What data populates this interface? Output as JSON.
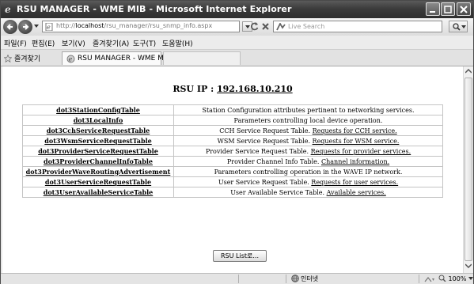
{
  "window": {
    "title": "RSU MANAGER - WME MIB - Microsoft Internet Explorer"
  },
  "address_bar": {
    "url_prefix": "http://",
    "url_host": "localhost",
    "url_path": "/rsu_manager/rsu_snmp_info.aspx",
    "search_placeholder": "Live Search"
  },
  "menu": {
    "items": [
      {
        "label": "파일(F)"
      },
      {
        "label": "편집(E)"
      },
      {
        "label": "보기(V)"
      },
      {
        "label": "즐겨찾기(A)"
      },
      {
        "label": "도구(T)"
      },
      {
        "label": "도움말(H)"
      }
    ]
  },
  "tabs": {
    "favorites_label": "즐겨찾기",
    "active_tab": "RSU MANAGER - WME MIB"
  },
  "page": {
    "heading_label": "RSU IP :",
    "ip": "192.168.10.210",
    "rows": [
      {
        "name": "dot3StationConfigTable",
        "desc": "Station Configuration attributes pertinent to networking services.",
        "link": ""
      },
      {
        "name": "dot3LocalInfo",
        "desc": "Parameters controlling local device operation.",
        "link": ""
      },
      {
        "name": "dot3CchServiceRequestTable",
        "desc": "CCH Service Request Table.",
        "link": "Requests for CCH service."
      },
      {
        "name": "dot3WsmServiceRequestTable",
        "desc": "WSM Service Request Table.",
        "link": "Requests for WSM service."
      },
      {
        "name": "dot3ProviderServiceRequestTable",
        "desc": "Provider Service Request Table.",
        "link": "Requests for provider services."
      },
      {
        "name": "dot3ProviderChannelInfoTable",
        "desc": "Provider Channel Info Table.",
        "link": "Channel information."
      },
      {
        "name": "dot3ProviderWaveRoutingAdvertisement",
        "desc": "Parameters controlling operation in the WAVE IP network.",
        "link": ""
      },
      {
        "name": "dot3UserServiceRequestTable",
        "desc": "User Service Request Table.",
        "link": "Requests for user services."
      },
      {
        "name": "dot3UserAvailableServiceTable",
        "desc": "User Available Service Table.",
        "link": "Available services."
      }
    ],
    "button_label": "RSU List로..."
  },
  "status": {
    "zone": "인터넷",
    "zoom": "100%"
  }
}
